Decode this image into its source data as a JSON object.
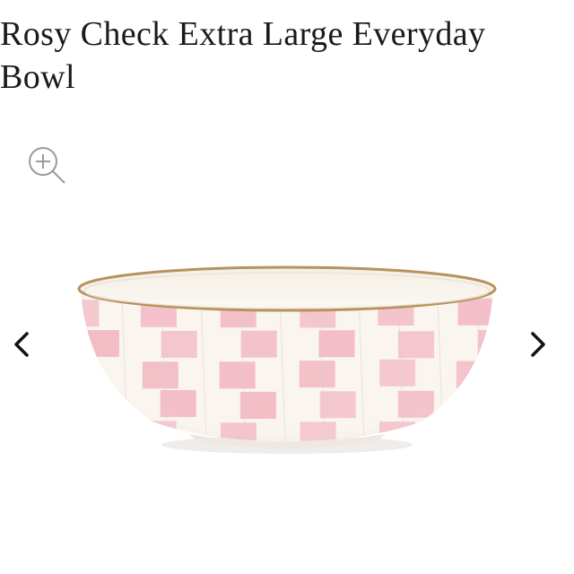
{
  "product": {
    "title": "Rosy Check Extra Large Everyday Bowl",
    "image_alt": "Rosy Check Extra Large Everyday Bowl",
    "pattern_colors": {
      "pink": "#f2b9c4",
      "cream": "#faf5ee",
      "rim": "#b8925c"
    }
  },
  "gallery": {
    "zoom_icon": "zoom-in-icon",
    "prev_icon": "chevron-left-icon",
    "next_icon": "chevron-right-icon"
  }
}
